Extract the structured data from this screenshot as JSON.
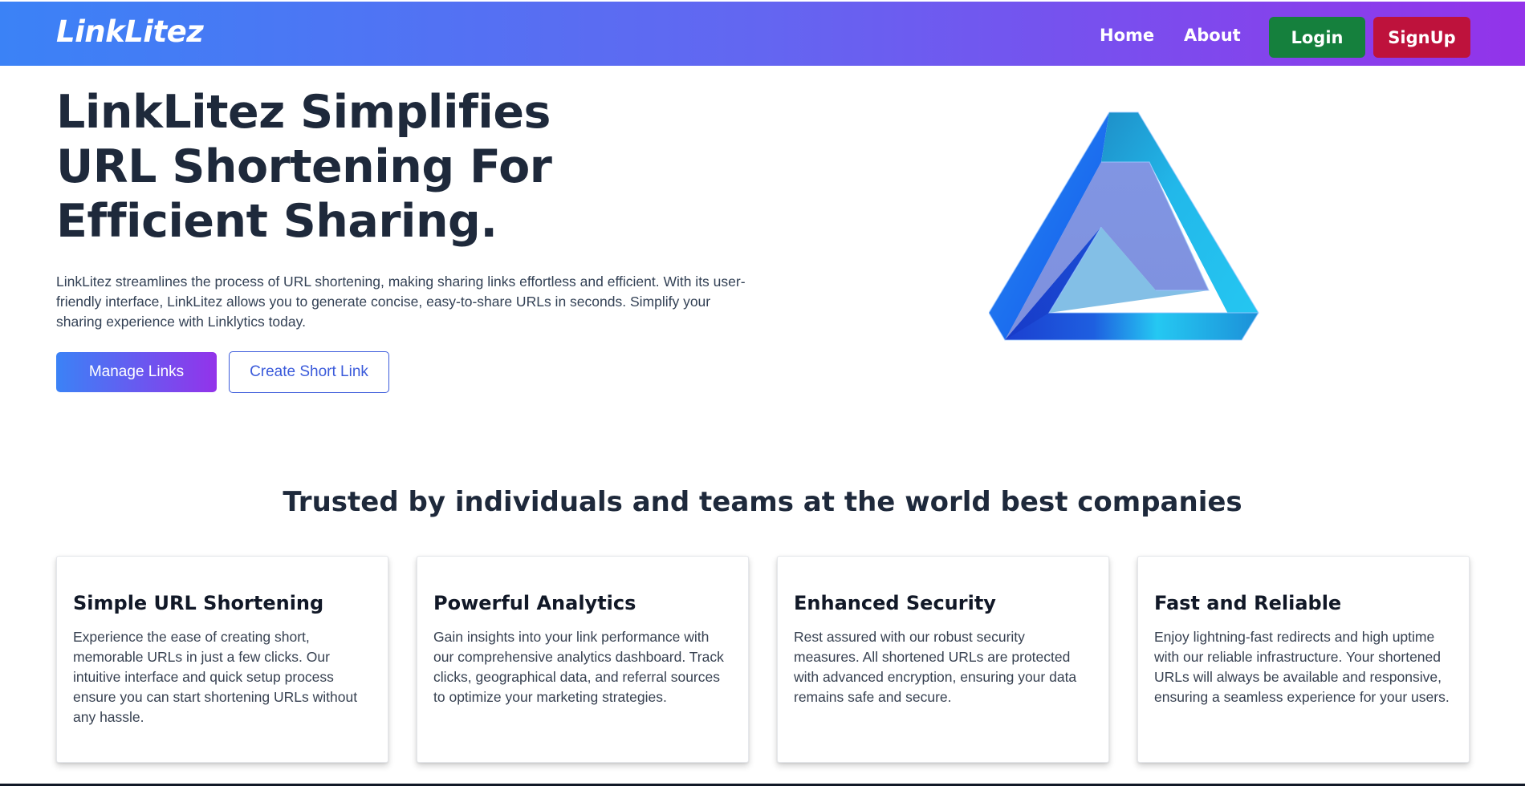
{
  "brand": {
    "logo": "LinkLitez"
  },
  "nav": {
    "home": "Home",
    "about": "About",
    "login": "Login",
    "signup": "SignUp"
  },
  "hero": {
    "title": "LinkLitez Simplifies URL Shortening For Efficient Sharing.",
    "description": "LinkLitez streamlines the process of URL shortening, making sharing links effortless and efficient. With its user-friendly interface, LinkLitez allows you to generate concise, easy-to-share URLs in seconds. Simplify your sharing experience with Linklytics today.",
    "manage_button": "Manage Links",
    "create_button": "Create Short Link"
  },
  "section": {
    "title": "Trusted by individuals and teams at the world best companies"
  },
  "cards": [
    {
      "title": "Simple URL Shortening",
      "body": "Experience the ease of creating short, memorable URLs in just a few clicks. Our intuitive interface and quick setup process ensure you can start shortening URLs without any hassle."
    },
    {
      "title": "Powerful Analytics",
      "body": "Gain insights into your link performance with our comprehensive analytics dashboard. Track clicks, geographical data, and referral sources to optimize your marketing strategies."
    },
    {
      "title": "Enhanced Security",
      "body": "Rest assured with our robust security measures. All shortened URLs are protected with advanced encryption, ensuring your data remains safe and secure."
    },
    {
      "title": "Fast and Reliable",
      "body": "Enjoy lightning-fast redirects and high uptime with our reliable infrastructure. Your shortened URLs will always be available and responsive, ensuring a seamless experience for your users."
    }
  ],
  "colors": {
    "nav_gradient_start": "#3b82f6",
    "nav_gradient_end": "#9333ea",
    "login": "#15803d",
    "signup": "#be123c",
    "accent": "#3b5bdb"
  },
  "icons": {
    "hero_art": "impossible-triangle-icon"
  }
}
